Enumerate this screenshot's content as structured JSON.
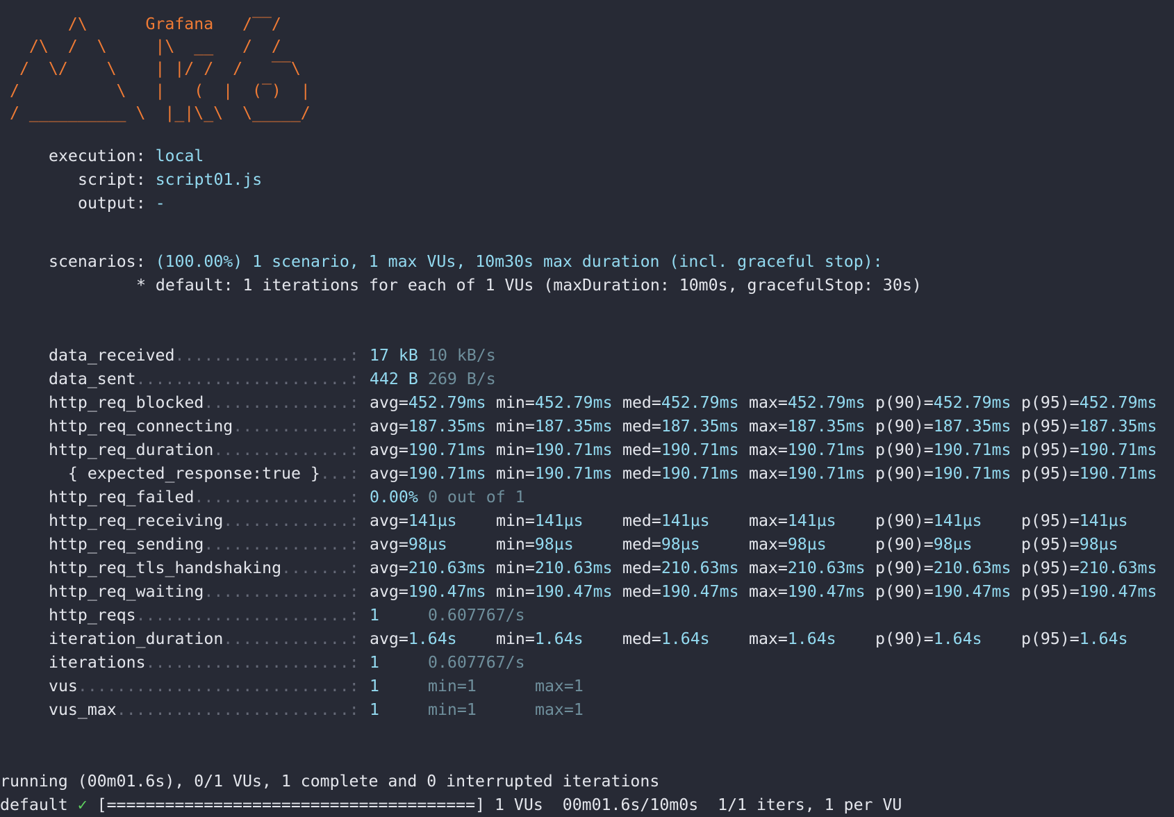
{
  "logo": {
    "lines": [
      "      /\\      Grafana   /‾‾/",
      "  /\\  /  \\     |\\  __   /  /",
      " /  \\/    \\    | |/ /  /   ‾‾\\",
      "/          \\   |   (  |  (‾)  |",
      "/ __________ \\  |_|\\_\\  \\_____/"
    ],
    "brand": "Grafana"
  },
  "info": {
    "execution_label": "execution:",
    "execution_value": "local",
    "script_label": "script:",
    "script_value": "script01.js",
    "output_label": "output:",
    "output_value": "-",
    "scenarios_label": "scenarios:",
    "scenarios_value": "(100.00%) 1 scenario, 1 max VUs, 10m30s max duration (incl. graceful stop):",
    "default_line": "* default: 1 iterations for each of 1 VUs (maxDuration: 10m0s, gracefulStop: 30s)"
  },
  "metrics": [
    {
      "name": "data_received",
      "dots": "..................: ",
      "v1": "17 kB",
      "v2": "10 kB/s"
    },
    {
      "name": "data_sent",
      "dots": "......................: ",
      "v1": "442 B",
      "v2": "269 B/s"
    },
    {
      "name": "http_req_blocked",
      "dots": "...............: ",
      "avg": "452.79ms",
      "min": "452.79ms",
      "med": "452.79ms",
      "max": "452.79ms",
      "p90": "452.79ms",
      "p95": "452.79ms"
    },
    {
      "name": "http_req_connecting",
      "dots": "............: ",
      "avg": "187.35ms",
      "min": "187.35ms",
      "med": "187.35ms",
      "max": "187.35ms",
      "p90": "187.35ms",
      "p95": "187.35ms"
    },
    {
      "name": "http_req_duration",
      "dots": "..............: ",
      "avg": "190.71ms",
      "min": "190.71ms",
      "med": "190.71ms",
      "max": "190.71ms",
      "p90": "190.71ms",
      "p95": "190.71ms"
    },
    {
      "name": "  { expected_response:true }",
      "dots": "...: ",
      "avg": "190.71ms",
      "min": "190.71ms",
      "med": "190.71ms",
      "max": "190.71ms",
      "p90": "190.71ms",
      "p95": "190.71ms"
    },
    {
      "name": "http_req_failed",
      "dots": "................: ",
      "v1": "0.00%",
      "v2": "0 out of 1"
    },
    {
      "name": "http_req_receiving",
      "dots": ".............: ",
      "avg": "141µs",
      "min": "141µs",
      "med": "141µs",
      "max": "141µs",
      "p90": "141µs",
      "p95": "141µs"
    },
    {
      "name": "http_req_sending",
      "dots": "...............: ",
      "avg": "98µs",
      "min": "98µs",
      "med": "98µs",
      "max": "98µs",
      "p90": "98µs",
      "p95": "98µs"
    },
    {
      "name": "http_req_tls_handshaking",
      "dots": ".......: ",
      "avg": "210.63ms",
      "min": "210.63ms",
      "med": "210.63ms",
      "max": "210.63ms",
      "p90": "210.63ms",
      "p95": "210.63ms"
    },
    {
      "name": "http_req_waiting",
      "dots": "...............: ",
      "avg": "190.47ms",
      "min": "190.47ms",
      "med": "190.47ms",
      "max": "190.47ms",
      "p90": "190.47ms",
      "p95": "190.47ms"
    },
    {
      "name": "http_reqs",
      "dots": "......................: ",
      "v1": "1",
      "v2": "0.607767/s"
    },
    {
      "name": "iteration_duration",
      "dots": ".............: ",
      "avg": "1.64s",
      "min": "1.64s",
      "med": "1.64s",
      "max": "1.64s",
      "p90": "1.64s",
      "p95": "1.64s"
    },
    {
      "name": "iterations",
      "dots": ".....................: ",
      "v1": "1",
      "v2": "0.607767/s"
    },
    {
      "name": "vus",
      "dots": "............................: ",
      "v1": "1",
      "v2": "min=1",
      "v3": "max=1"
    },
    {
      "name": "vus_max",
      "dots": "........................: ",
      "v1": "1",
      "v2": "min=1",
      "v3": "max=1"
    }
  ],
  "labels": {
    "avg": "avg=",
    "min": "min=",
    "med": "med=",
    "max": "max=",
    "p90": "p(90)=",
    "p95": "p(95)="
  },
  "footer": {
    "running": "running (00m01.6s), 0/1 VUs, 1 complete and 0 interrupted iterations",
    "default_label": "default",
    "check": "✓",
    "progress": "[======================================]",
    "vus": "1 VUs",
    "elapsed": "00m01.6s/10m0s",
    "iters": "1/1 iters, 1 per VU"
  },
  "colors": {
    "background": "#272a35",
    "logo": "#f07b35",
    "value": "#93daf0",
    "secondary": "#6f8f9c",
    "dots": "#656977",
    "check": "#5fd35f"
  }
}
